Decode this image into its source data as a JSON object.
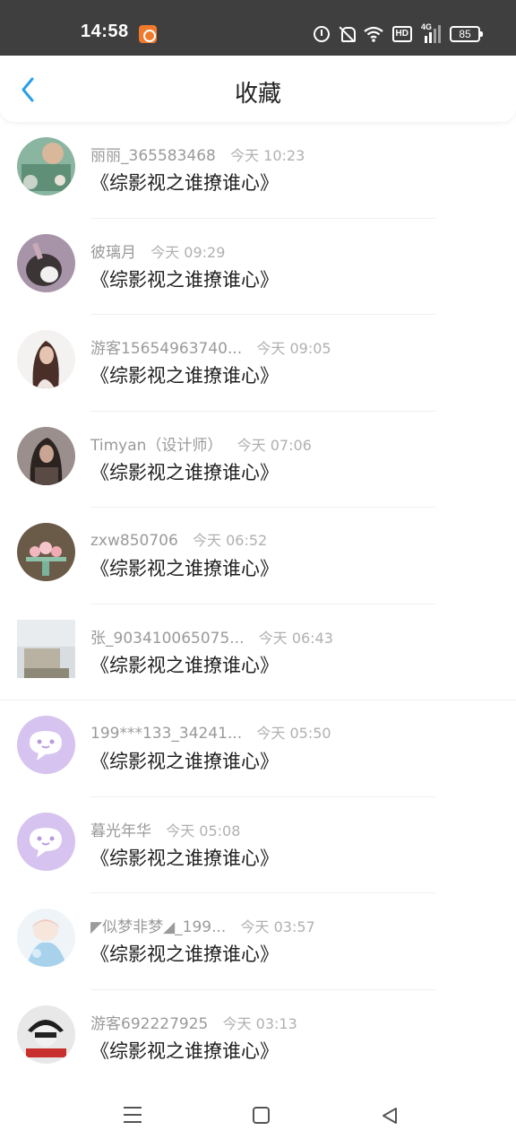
{
  "status_bar": {
    "time": "14:58",
    "battery": "85",
    "network_label": "4G",
    "hd_label": "HD",
    "icons": [
      "app-notification-icon",
      "alarm-icon",
      "mute-icon",
      "wifi-icon",
      "hd-icon",
      "signal-icon",
      "battery-icon"
    ]
  },
  "header": {
    "title": "收藏",
    "back_icon": "chevron-left-icon",
    "accent_color": "#2a9ee6"
  },
  "items": [
    {
      "name": "丽丽_365583468",
      "time": "今天 10:23",
      "title": "《综影视之谁撩谁心》"
    },
    {
      "name": "彼璃月",
      "time": "今天 09:29",
      "title": "《综影视之谁撩谁心》"
    },
    {
      "name": "游客15654963740...",
      "time": "今天 09:05",
      "title": "《综影视之谁撩谁心》"
    },
    {
      "name": "Timyan（设计师）",
      "time": "今天 07:06",
      "title": "《综影视之谁撩谁心》"
    },
    {
      "name": "zxw850706",
      "time": "今天 06:52",
      "title": "《综影视之谁撩谁心》"
    },
    {
      "name": "张_903410065075...",
      "time": "今天 06:43",
      "title": "《综影视之谁撩谁心》"
    },
    {
      "name": "199***133_34241...",
      "time": "今天 05:50",
      "title": "《综影视之谁撩谁心》"
    },
    {
      "name": "暮光年华",
      "time": "今天 05:08",
      "title": "《综影视之谁撩谁心》"
    },
    {
      "name": "◤似梦非梦◢_199...",
      "time": "今天 03:57",
      "title": "《综影视之谁撩谁心》"
    },
    {
      "name": "游客692227925",
      "time": "今天 03:13",
      "title": "《综影视之谁撩谁心》"
    }
  ],
  "nav_bar": {
    "icons": [
      "menu-icon",
      "home-icon",
      "back-triangle-icon"
    ]
  }
}
